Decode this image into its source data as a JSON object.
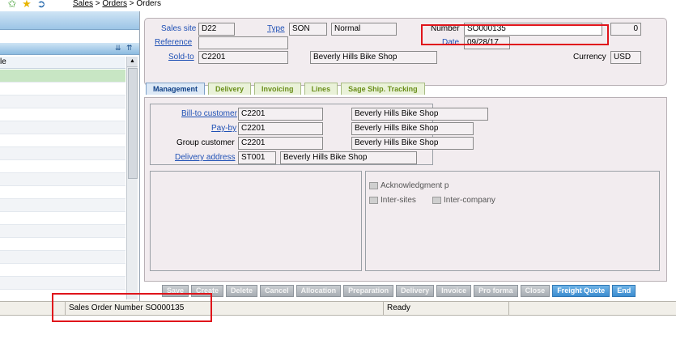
{
  "topbar": {
    "icons": [
      "add-favorite-icon",
      "favorite-star-icon",
      "navigation-icon"
    ],
    "breadcrumb": [
      {
        "label": "Sales",
        "link": true
      },
      {
        "label": " > ",
        "link": false
      },
      {
        "label": "Orders",
        "link": true
      },
      {
        "label": " > Orders",
        "link": false
      }
    ]
  },
  "left_panel": {
    "column_header": "le",
    "scroll_up": "▲",
    "collapse_icons": [
      "⇊",
      "⇈"
    ]
  },
  "header": {
    "sales_site_label": "Sales site",
    "sales_site_value": "D22",
    "type_label": "Type",
    "type_value": "SON",
    "type_desc": "Normal",
    "number_label": "Number",
    "number_value": "SO000135",
    "counter_value": "0",
    "reference_label": "Reference",
    "reference_value": "",
    "date_label": "Date",
    "date_value": "09/28/17",
    "sold_to_label": "Sold-to",
    "sold_to_value": "C2201",
    "sold_to_name": "Beverly Hills Bike Shop",
    "currency_label": "Currency",
    "currency_value": "USD"
  },
  "tabs": [
    "Management",
    "Delivery",
    "Invoicing",
    "Lines",
    "Sage Ship. Tracking"
  ],
  "management": {
    "bill_to_label": "Bill-to customer",
    "bill_to_value": "C2201",
    "bill_to_name": "Beverly Hills Bike Shop",
    "pay_by_label": "Pay-by",
    "pay_by_value": "C2201",
    "pay_by_name": "Beverly Hills Bike Shop",
    "group_label": "Group customer",
    "group_value": "C2201",
    "group_name": "Beverly Hills Bike Shop",
    "delivery_label": "Delivery address",
    "delivery_value": "ST001",
    "delivery_name": "Beverly Hills Bike Shop",
    "ack_label": "Acknowledgment p",
    "inter_sites_label": "Inter-sites",
    "inter_company_label": "Inter-company"
  },
  "buttons": [
    "Save",
    "Create",
    "Delete",
    "Cancel",
    "Allocation",
    "Preparation",
    "Delivery",
    "Invoice",
    "Pro forma",
    "Close",
    "Freight Quote",
    "End"
  ],
  "status": {
    "message": "Sales Order Number SO000135",
    "state": "Ready"
  },
  "colors": {
    "highlight_red": "#e0141b",
    "link_blue": "#1f50b5",
    "tab_green": "#6a8f1a",
    "form_bg": "#f2ecef"
  }
}
